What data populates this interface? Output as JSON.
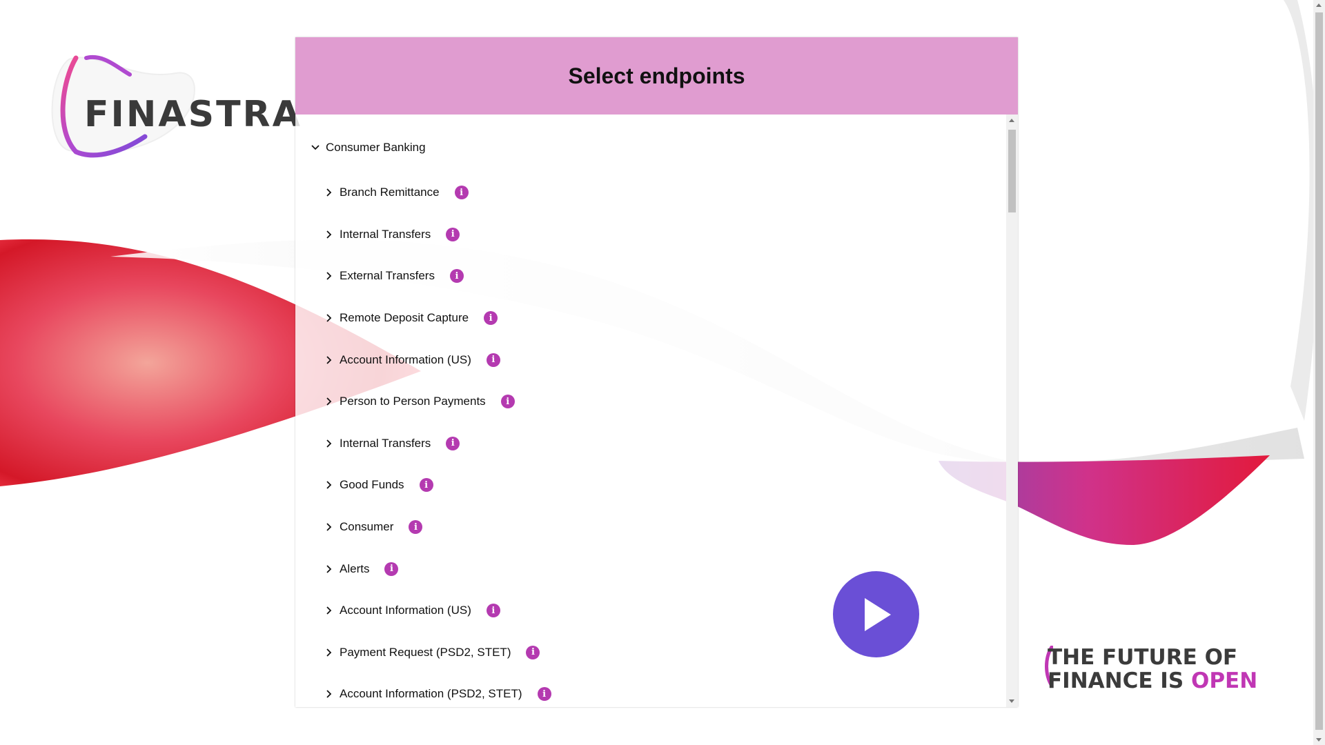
{
  "brand": {
    "logo_text": "FINASTRA",
    "colors": {
      "accent": "#b43ab0",
      "header": "#e09cd0",
      "play": "#6a4fd6"
    }
  },
  "panel": {
    "title": "Select endpoints",
    "category": {
      "label": "Consumer Banking",
      "expanded": true
    },
    "endpoints": [
      {
        "label": "Branch Remittance"
      },
      {
        "label": "Internal Transfers"
      },
      {
        "label": "External Transfers"
      },
      {
        "label": "Remote Deposit Capture"
      },
      {
        "label": "Account Information (US)"
      },
      {
        "label": "Person to Person Payments"
      },
      {
        "label": "Internal Transfers"
      },
      {
        "label": "Good Funds"
      },
      {
        "label": "Consumer"
      },
      {
        "label": "Alerts"
      },
      {
        "label": "Account Information (US)"
      },
      {
        "label": "Payment Request (PSD2, STET)"
      },
      {
        "label": "Account Information (PSD2, STET)"
      }
    ],
    "info_icon": "i"
  },
  "tagline": {
    "line1": "THE FUTURE OF",
    "line2_prefix": "FINANCE IS ",
    "line2_highlight": "OPEN"
  },
  "icons": {
    "play": "play-icon",
    "chevron_down": "chevron-down-icon",
    "chevron_right": "chevron-right-icon",
    "info": "info-icon"
  }
}
